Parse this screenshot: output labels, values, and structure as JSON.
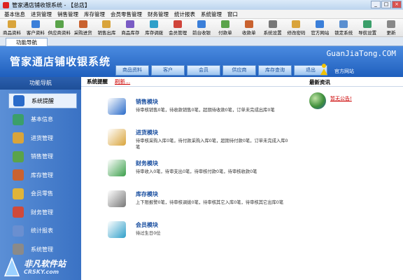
{
  "window": {
    "title": "管家通店铺收银系统 - 【总店】",
    "min": "_",
    "max": "□",
    "close": "×"
  },
  "menu": [
    "基本信息",
    "进货管理",
    "销售管理",
    "库存管理",
    "会员零售管理",
    "财务管理",
    "统计报表",
    "系统管理",
    "窗口"
  ],
  "toolbar": [
    {
      "label": "商品资料",
      "color": "#d9a43b"
    },
    {
      "label": "客户资料",
      "color": "#3b7fd9"
    },
    {
      "label": "供应商资料",
      "color": "#5aa34a"
    },
    {
      "label": "采购进货",
      "color": "#c9622f"
    },
    {
      "label": "销售出库",
      "color": "#d9a43b"
    },
    {
      "label": "商品库存",
      "color": "#7a5bc4"
    },
    {
      "label": "库存调拨",
      "color": "#2f9fc9"
    },
    {
      "label": "会员管理",
      "color": "#d0443a"
    },
    {
      "label": "前台收银",
      "color": "#3b7fd9"
    },
    {
      "label": "付款单",
      "color": "#5aa34a"
    },
    {
      "label": "收款单",
      "color": "#c9622f"
    },
    {
      "label": "系统设置",
      "color": "#777777"
    },
    {
      "label": "修改密码",
      "color": "#d9a43b"
    },
    {
      "label": "官方网站",
      "color": "#3b7fd9"
    },
    {
      "label": "锁定系统",
      "color": "#5a8fd0"
    },
    {
      "label": "导航设置",
      "color": "#3b9f6a"
    },
    {
      "label": "更新",
      "color": "#888888"
    }
  ],
  "tab": {
    "label": "功能导航"
  },
  "header": {
    "title": "管家通店铺收银系统",
    "site": "GuanJiaTong.COM",
    "official_label": "官方网站",
    "nav": [
      "商品资料",
      "客户",
      "会员",
      "供应商",
      "库存查询",
      "退出"
    ]
  },
  "sidebar": {
    "title": "功能导航",
    "items": [
      {
        "label": "系统提醒",
        "color": "#2a6bc9",
        "active": true
      },
      {
        "label": "基本信息",
        "color": "#3b9f6a",
        "active": false
      },
      {
        "label": "进货管理",
        "color": "#d9a43b",
        "active": false
      },
      {
        "label": "销售管理",
        "color": "#5aa34a",
        "active": false
      },
      {
        "label": "库存管理",
        "color": "#c9622f",
        "active": false
      },
      {
        "label": "会员零售",
        "color": "#e0b43a",
        "active": false
      },
      {
        "label": "财务管理",
        "color": "#d04a3a",
        "active": false
      },
      {
        "label": "统计报表",
        "color": "#6a8fd0",
        "active": false
      },
      {
        "label": "系统管理",
        "color": "#8a8a8a",
        "active": false
      }
    ]
  },
  "main": {
    "breadcrumb": "系统提醒",
    "more": "刷新...",
    "news_title": "最新资讯",
    "notice": "暂无公告!"
  },
  "modules": [
    {
      "title": "销售模块",
      "icon": "book-icon",
      "color": "#2a6bc9",
      "lines": [
        "待审核销售0笔，待收款销售0笔，超期待收款0笔，订单未完成出库0笔"
      ]
    },
    {
      "title": "进货模块",
      "icon": "box-icon",
      "color": "#d9a43b",
      "lines": [
        "待审核采购入库0笔，待付款采购入库0笔，超期待付款0笔，订单未完成入库0",
        "笔"
      ]
    },
    {
      "title": "财务模块",
      "icon": "money-icon",
      "color": "#3b9f4a",
      "lines": [
        "待审收入0笔，待审支出0笔，待审核付款0笔，待审核收款0笔"
      ]
    },
    {
      "title": "库存模块",
      "icon": "database-icon",
      "color": "#777777",
      "lines": [
        "上下限报警0笔，待审核调拨0笔，待审核其它入库0笔，待审核其它出库0笔"
      ]
    },
    {
      "title": "会员模块",
      "icon": "members-icon",
      "color": "#2f9fc9",
      "lines": [
        "待过生日0位"
      ]
    }
  ],
  "watermark": {
    "main": "非凡软件站",
    "sub": "CRSKY.com"
  }
}
